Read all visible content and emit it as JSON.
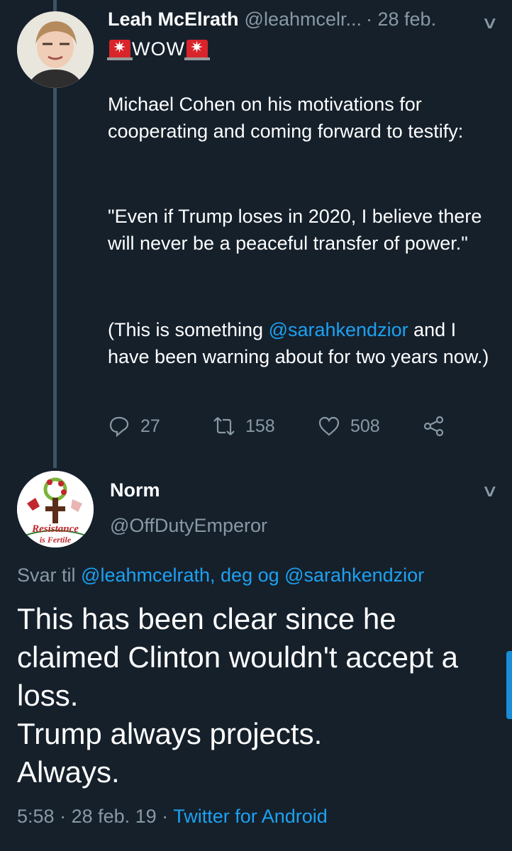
{
  "tweet1": {
    "author_name": "Leah McElrath",
    "author_handle": "@leahmcelr...",
    "date": "· 28 feb.",
    "wow": "WOW",
    "para1": "Michael Cohen on his motivations for cooperating and coming forward to testify:",
    "para2": "\"Even if Trump loses in 2020, I believe there will never be a peaceful transfer of power.\"",
    "para3_before": "(This is something ",
    "para3_mention": "@sarahkendzior",
    "para3_after": " and I have been warning about for two years now.)",
    "reply_count": "27",
    "retweet_count": "158",
    "like_count": "508"
  },
  "tweet2": {
    "author_name": "Norm",
    "author_handle": "@OffDutyEmperor",
    "avatar_text_1": "Resistance",
    "avatar_text_2": "is Fertile",
    "reply_prefix": "Svar til ",
    "reply_mention_1": "@leahmcelrath",
    "reply_mid": ", deg og ",
    "reply_mention_2": "@sarahkendzior",
    "line1": "This has been clear since he claimed Clinton wouldn't accept a loss.",
    "line2": "Trump always projects.",
    "line3": "Always.",
    "time": "5:58",
    "date": "· 28 feb. 19 ·",
    "source": "Twitter for Android"
  },
  "colors": {
    "background": "#15202b",
    "accent": "#1da1f2",
    "muted": "#8899a6",
    "siren": "#d8252b"
  },
  "icons": [
    "reply-icon",
    "retweet-icon",
    "like-icon",
    "share-icon",
    "chevron-down-icon",
    "siren-emoji-icon"
  ]
}
